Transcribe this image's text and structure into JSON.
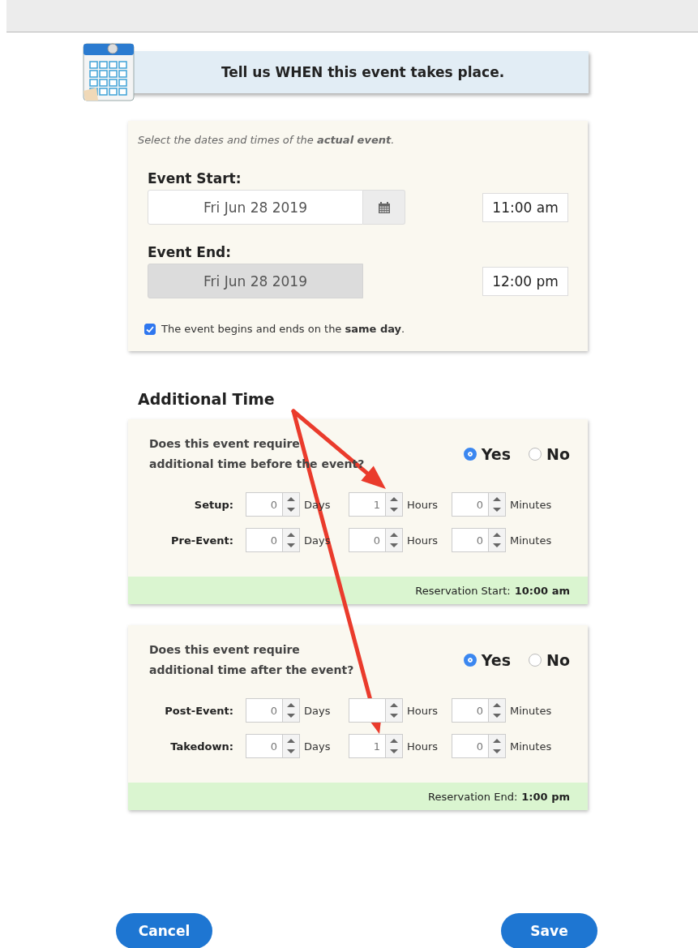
{
  "header": {
    "title": "Tell us WHEN this event takes place."
  },
  "event_card": {
    "instruction": "Select the dates and times of the **actual event**.",
    "dates": [
      {
        "label": "Event Start:",
        "date": "Fri Jun 28 2019",
        "disabled": false,
        "time": "11:00 am"
      },
      {
        "label": "Event End:",
        "date": "Fri Jun 28 2019",
        "disabled": true,
        "time": "12:00 pm"
      }
    ],
    "same_day": {
      "label": "The event begins and ends on the **same day**.",
      "checked": true
    }
  },
  "additional": {
    "title": "Additional Time",
    "sections": [
      {
        "question": "Does this event require\nadditional time before the event?",
        "options": [
          {
            "label": "Yes",
            "selected": true
          },
          {
            "label": "No",
            "selected": false
          }
        ],
        "rows": [
          {
            "label": "Setup:",
            "fields": [
              {
                "value": "0",
                "unit": "Days"
              },
              {
                "value": "1",
                "unit": "Hours"
              },
              {
                "value": "0",
                "unit": "Minutes"
              }
            ]
          },
          {
            "label": "Pre-Event:",
            "fields": [
              {
                "value": "0",
                "unit": "Days"
              },
              {
                "value": "0",
                "unit": "Hours"
              },
              {
                "value": "0",
                "unit": "Minutes"
              }
            ]
          }
        ],
        "footer_label": "Reservation Start:",
        "footer_value": "10:00 am"
      },
      {
        "question": "Does this event require\nadditional time after the event?",
        "options": [
          {
            "label": "Yes",
            "selected": true
          },
          {
            "label": "No",
            "selected": false
          }
        ],
        "rows": [
          {
            "label": "Post-Event:",
            "fields": [
              {
                "value": "0",
                "unit": "Days"
              },
              {
                "unit": "Hours"
              },
              {
                "value": "0",
                "unit": "Minutes"
              }
            ]
          },
          {
            "label": "Takedown:",
            "fields": [
              {
                "value": "0",
                "unit": "Days"
              },
              {
                "value": "1",
                "unit": "Hours"
              },
              {
                "value": "0",
                "unit": "Minutes"
              }
            ]
          }
        ],
        "footer_label": "Reservation End:",
        "footer_value": "1:00 pm"
      }
    ]
  },
  "buttons": [
    {
      "label": "Cancel"
    },
    {
      "label": "Save"
    }
  ]
}
